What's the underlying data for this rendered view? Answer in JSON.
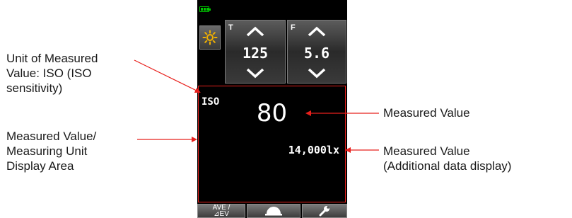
{
  "callouts": {
    "unit": [
      "Unit of Measured",
      "Value: ISO (ISO",
      "sensitivity)"
    ],
    "display_area": [
      "Measured Value/",
      "Measuring Unit",
      "Display Area"
    ],
    "measured_value": "Measured Value",
    "additional": [
      "Measured Value",
      "(Additional data display)"
    ]
  },
  "device": {
    "mode_icon": "sun-icon",
    "controls": [
      {
        "tag": "T",
        "value": "125"
      },
      {
        "tag": "F",
        "value": "5.6"
      }
    ],
    "unit": "ISO",
    "measured_value": "80",
    "additional_value": "14,000lx",
    "bottom_buttons": {
      "ave_line1": "AVE /",
      "ave_line2": "⊿EV",
      "dome_icon": "dome-icon",
      "wrench_icon": "wrench-icon"
    }
  },
  "colors": {
    "annotation": "#e8201c",
    "battery": "#00c800",
    "mode_icon": "#f0b000"
  }
}
